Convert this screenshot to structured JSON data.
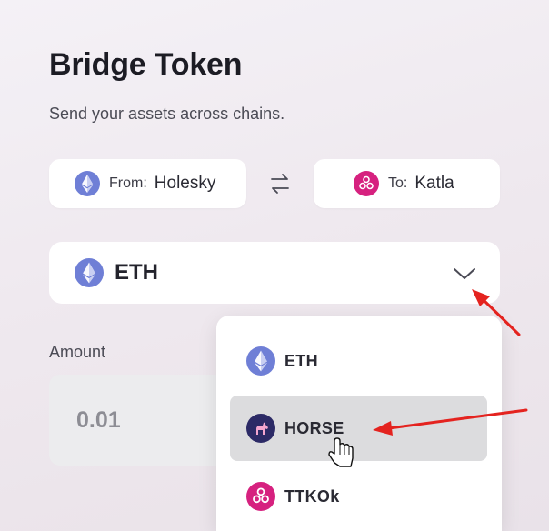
{
  "page": {
    "title": "Bridge Token",
    "subtitle": "Send your assets across chains."
  },
  "chains": {
    "from": {
      "label": "From:",
      "name": "Holesky",
      "icon": "ethereum-icon"
    },
    "to": {
      "label": "To:",
      "name": "Katla",
      "icon": "taiko-icon"
    },
    "swap_icon": "swap-arrows-icon"
  },
  "token_select": {
    "selected": "ETH",
    "icon": "ethereum-icon",
    "chevron_icon": "chevron-down-icon"
  },
  "amount": {
    "label": "Amount",
    "value": "0.01"
  },
  "dropdown": {
    "options": [
      {
        "label": "ETH",
        "icon": "ethereum-icon",
        "hovered": false
      },
      {
        "label": "HORSE",
        "icon": "horse-icon",
        "hovered": true
      },
      {
        "label": "TTKOk",
        "icon": "taiko-icon",
        "hovered": false
      }
    ]
  },
  "colors": {
    "ethereum_blue": "#6f7fd6",
    "taiko_pink": "#d6217f",
    "horse_navy": "#2c2a66",
    "horse_pink": "#f4a6cf",
    "annotation_red": "#e4231f",
    "hover_gray": "#dcdcde"
  }
}
